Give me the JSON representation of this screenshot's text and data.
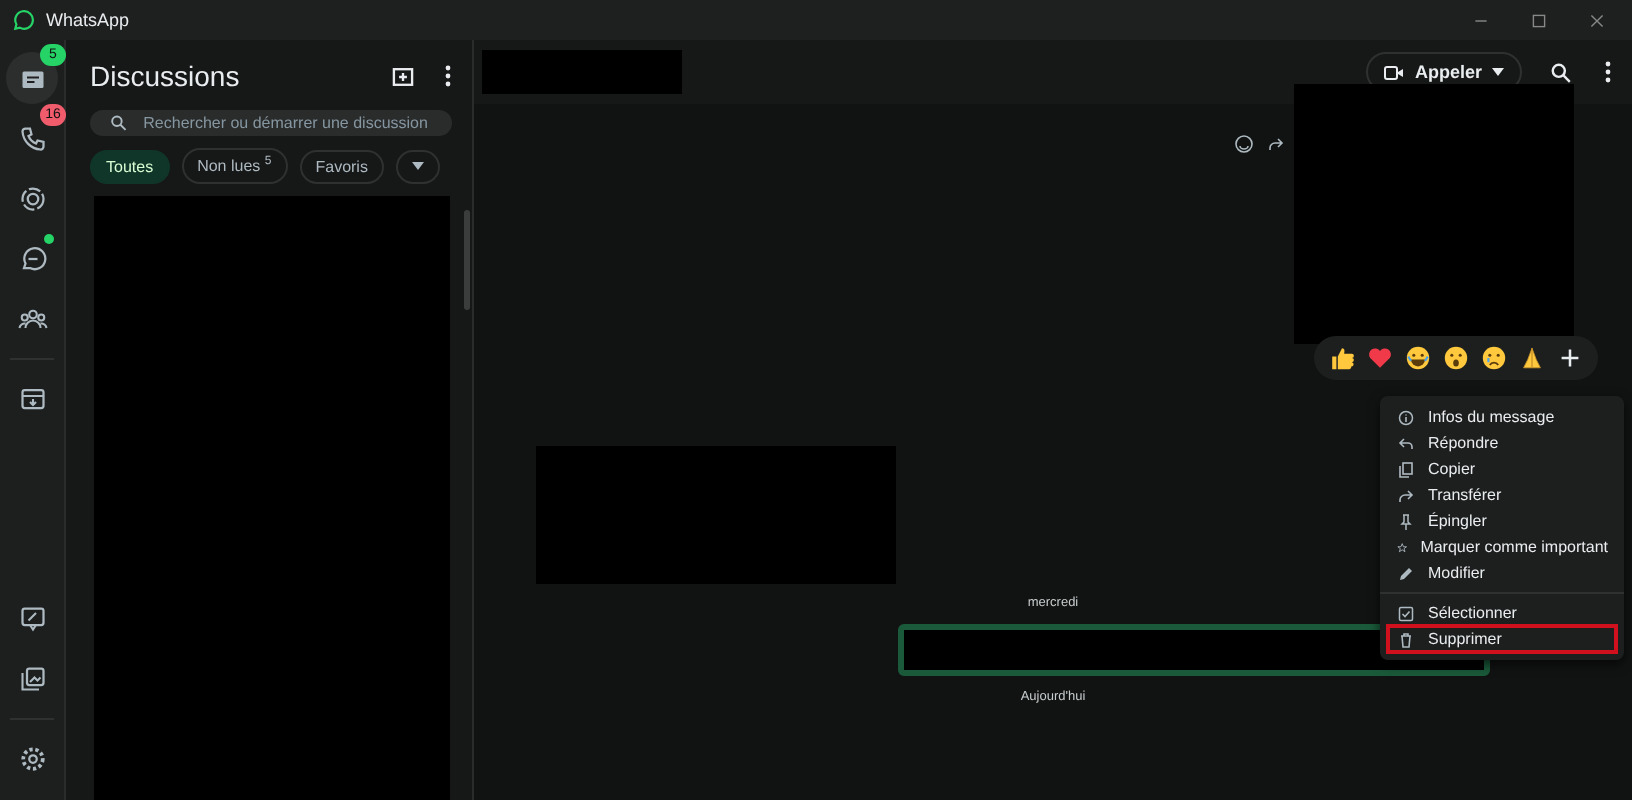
{
  "window": {
    "title": "WhatsApp"
  },
  "rail": {
    "top": [
      {
        "kind": "chats",
        "selected": true,
        "badge": "5",
        "color": "#25d366"
      },
      {
        "kind": "calls",
        "selected": false,
        "badge": "16",
        "color": "#f15c6d"
      },
      {
        "kind": "status",
        "selected": false
      },
      {
        "kind": "channels",
        "selected": false,
        "dot": true
      },
      {
        "kind": "communities",
        "selected": false
      },
      {
        "kind": "archive",
        "selected": false
      }
    ],
    "bottom": [
      {
        "kind": "profile-board",
        "selected": false
      },
      {
        "kind": "media",
        "selected": false
      },
      {
        "kind": "settings",
        "selected": false
      }
    ]
  },
  "sidebar": {
    "title": "Discussions",
    "search": {
      "placeholder": "Rechercher ou démarrer une discussion"
    },
    "filters": [
      {
        "label": "Toutes",
        "selected": true
      },
      {
        "label": "Non lues",
        "count": "5",
        "selected": false
      },
      {
        "label": "Favoris",
        "selected": false
      }
    ]
  },
  "chat": {
    "call_button": "Appeler",
    "dates": [
      "mercredi",
      "Aujourd'hui"
    ],
    "reactions": [
      {
        "kind": "thumbs-up"
      },
      {
        "kind": "heart"
      },
      {
        "kind": "laughing"
      },
      {
        "kind": "surprised"
      },
      {
        "kind": "sad"
      },
      {
        "kind": "folded-hands"
      },
      {
        "kind": "plus"
      }
    ],
    "menu": [
      {
        "label": "Infos du message",
        "kind": "info",
        "highlighted": false,
        "divider_before": false
      },
      {
        "label": "Répondre",
        "kind": "reply",
        "highlighted": false,
        "divider_before": false
      },
      {
        "label": "Copier",
        "kind": "copy",
        "highlighted": false,
        "divider_before": false
      },
      {
        "label": "Transférer",
        "kind": "forward",
        "highlighted": false,
        "divider_before": false
      },
      {
        "label": "Épingler",
        "kind": "pin",
        "highlighted": false,
        "divider_before": false
      },
      {
        "label": "Marquer comme important",
        "kind": "star",
        "highlighted": false,
        "divider_before": false
      },
      {
        "label": "Modifier",
        "kind": "edit",
        "highlighted": false,
        "divider_before": false
      },
      {
        "label": "Sélectionner",
        "kind": "select",
        "highlighted": false,
        "divider_before": true
      },
      {
        "label": "Supprimer",
        "kind": "delete",
        "highlighted": true,
        "divider_before": false
      }
    ]
  }
}
